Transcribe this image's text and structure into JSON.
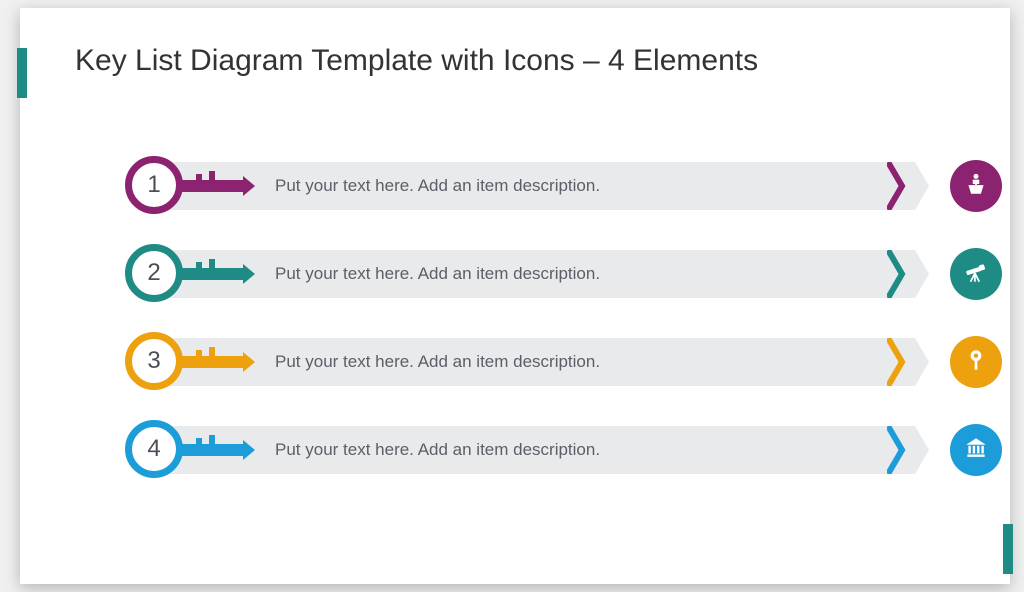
{
  "title": "Key List Diagram Template with Icons – 4 Elements",
  "rows": [
    {
      "num": "1",
      "text": "Put your text here. Add an item description.",
      "color": "#8b2370",
      "icon": "speaker-podium-icon"
    },
    {
      "num": "2",
      "text": "Put your text here. Add an item description.",
      "color": "#1f8b85",
      "icon": "telescope-icon"
    },
    {
      "num": "3",
      "text": "Put your text here. Add an item description.",
      "color": "#eda10e",
      "icon": "pushpin-icon"
    },
    {
      "num": "4",
      "text": "Put your text here. Add an item description.",
      "color": "#1c9dd9",
      "icon": "bank-building-icon"
    }
  ]
}
